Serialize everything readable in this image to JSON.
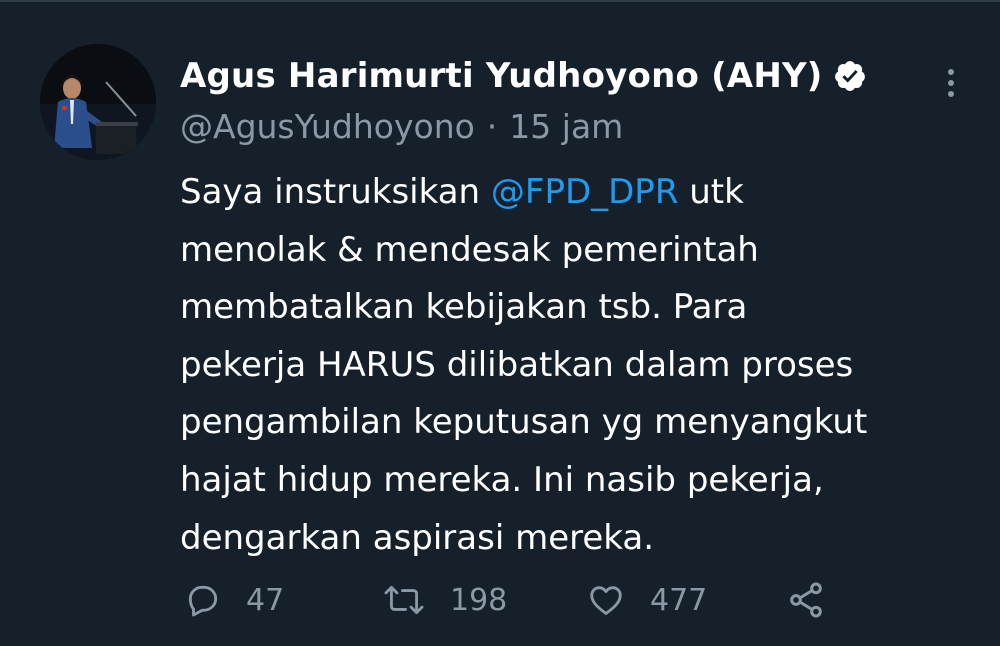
{
  "tweet": {
    "author": {
      "display_name": "Agus Harimurti Yudhoyono (AHY)",
      "handle": "@AgusYudhoyono",
      "verified": true,
      "avatar_icon": "avatar-photo-speaker-at-podium"
    },
    "timestamp": "15 jam",
    "separator": "·",
    "text_lines": [
      {
        "before": "Saya instruksikan ",
        "mention": "@FPD_DPR",
        "after": " utk"
      },
      {
        "text": "menolak & mendesak pemerintah"
      },
      {
        "text": "membatalkan kebijakan tsb. Para"
      },
      {
        "text": "pekerja HARUS dilibatkan dalam proses"
      },
      {
        "text": "pengambilan keputusan yg menyangkut"
      },
      {
        "text": "hajat hidup mereka. Ini nasib pekerja,"
      },
      {
        "text": "dengarkan aspirasi mereka."
      }
    ],
    "actions": {
      "reply": {
        "icon": "reply-bubble-icon",
        "count": "47"
      },
      "retweet": {
        "icon": "retweet-icon",
        "count": "198"
      },
      "like": {
        "icon": "heart-icon",
        "count": "477"
      },
      "share": {
        "icon": "share-icon"
      }
    },
    "more_icon": "more-vertical-icon"
  },
  "colors": {
    "background": "#15202b",
    "text_primary": "#ffffff",
    "text_secondary": "#8b98a5",
    "mention": "#1d9bf0"
  }
}
